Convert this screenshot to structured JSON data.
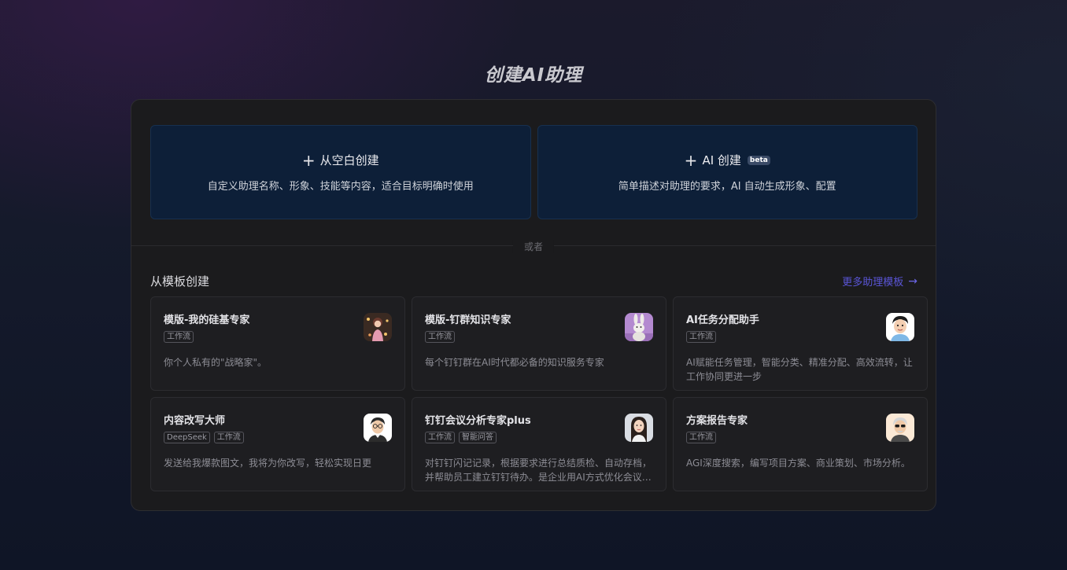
{
  "page": {
    "title": "创建AI助理"
  },
  "create_options": [
    {
      "title": "从空白创建",
      "desc": "自定义助理名称、形象、技能等内容，适合目标明确时使用",
      "icon": "plus-icon"
    },
    {
      "title": "AI 创建",
      "badge": "beta",
      "desc": "简单描述对助理的要求，AI 自动生成形象、配置",
      "icon": "plus-icon"
    }
  ],
  "divider_text": "或者",
  "templates_section": {
    "title": "从模板创建",
    "more_label": "更多助理模板",
    "more_icon": "arrow-right-icon",
    "items": [
      {
        "name": "模版-我的硅基专家",
        "tags": [
          "工作流"
        ],
        "desc": "你个人私有的\"战略家\"。",
        "avatar": "girl-garden-avatar"
      },
      {
        "name": "模版-钉群知识专家",
        "tags": [
          "工作流"
        ],
        "desc": "每个钉钉群在AI时代都必备的知识服务专家",
        "avatar": "bunny-avatar"
      },
      {
        "name": "AI任务分配助手",
        "tags": [
          "工作流"
        ],
        "desc": "AI赋能任务管理，智能分类、精准分配、高效流转，让工作协同更进一步",
        "avatar": "cartoon-man-avatar"
      },
      {
        "name": "内容改写大师",
        "tags": [
          "DeepSeek",
          "工作流"
        ],
        "desc": "发送给我爆款图文，我将为你改写，轻松实现日更",
        "avatar": "glasses-man-avatar"
      },
      {
        "name": "钉钉会议分析专家plus",
        "tags": [
          "工作流",
          "智能问答"
        ],
        "desc": "对钉钉闪记记录，根据要求进行总结质检、自动存档，并帮助员工建立钉钉待办。是企业用AI方式优化会议管理的好帮手",
        "avatar": "woman-avatar"
      },
      {
        "name": "方案报告专家",
        "tags": [
          "工作流"
        ],
        "desc": "AGI深度搜索，编写项目方案、商业策划、市场分析。",
        "avatar": "sunglasses-elder-avatar"
      }
    ]
  }
}
